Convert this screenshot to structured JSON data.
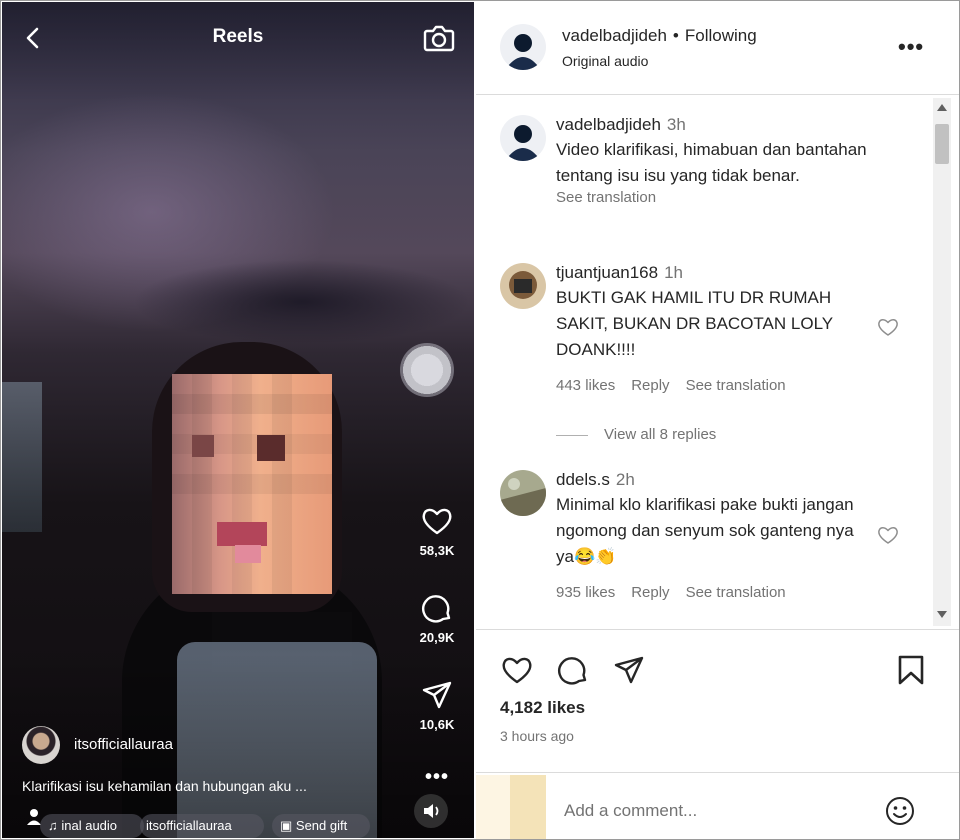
{
  "reel": {
    "header_title": "Reels",
    "actions": {
      "likes": "58,3K",
      "comments": "20,9K",
      "shares": "10,6K"
    },
    "author": "itsofficiallauraa",
    "caption": "Klarifikasi isu kehamilan dan hubungan aku ...",
    "chips": {
      "audio": "inal audio",
      "tagged": "itsofficiallauraa",
      "gift": "Send gift"
    }
  },
  "post": {
    "header": {
      "username": "vadelbadjideh",
      "separator": "•",
      "follow_state": "Following",
      "audio": "Original audio"
    },
    "comments": [
      {
        "username": "vadelbadjideh",
        "time": "3h",
        "text": "Video klarifikasi, himabuan dan bantahan tentang isu isu yang tidak benar.",
        "see_translation": "See translation"
      },
      {
        "username": "tjuantjuan168",
        "time": "1h",
        "text": "BUKTI GAK HAMIL ITU DR RUMAH SAKIT, BUKAN DR BACOTAN LOLY DOANK!!!!",
        "likes": "443 likes",
        "reply": "Reply",
        "see_translation": "See translation",
        "view_replies": "View all 8 replies"
      },
      {
        "username": "ddels.s",
        "time": "2h",
        "text": "Minimal klo klarifikasi pake bukti jangan ngomong dan senyum sok ganteng nya ya😂👏",
        "likes": "935 likes",
        "reply": "Reply",
        "see_translation": "See translation"
      }
    ],
    "likes": "4,182 likes",
    "posted_ago": "3 hours ago",
    "add_comment_placeholder": "Add a comment..."
  },
  "icons": [
    "back-arrow-icon",
    "camera-icon",
    "heart-icon",
    "comment-icon",
    "share-icon",
    "more-icon",
    "sound-icon",
    "bookmark-icon",
    "emoji-icon",
    "person-icon",
    "gift-icon",
    "music-icon"
  ]
}
